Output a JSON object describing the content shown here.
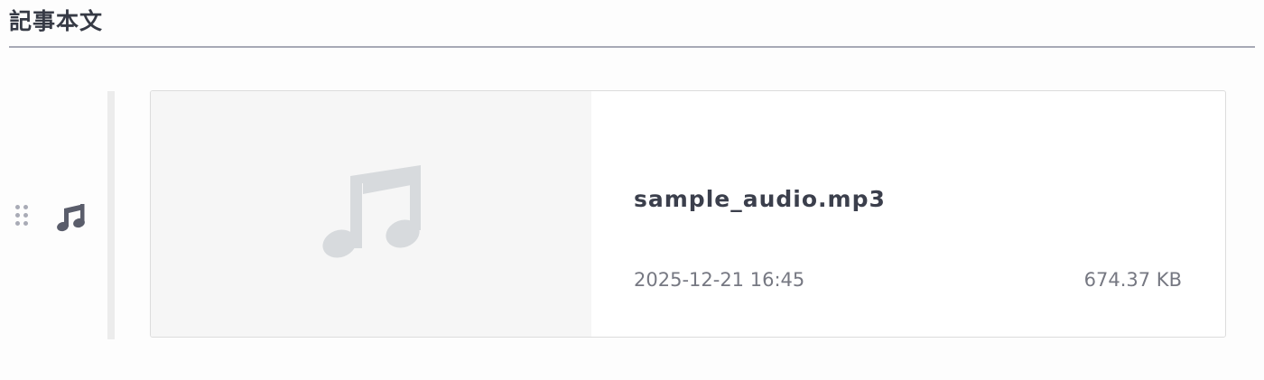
{
  "section": {
    "title": "記事本文"
  },
  "block": {
    "drag_handle_icon": "drag-dots-icon",
    "type_icon": "music-note-icon",
    "type_icon_color": "#5a5d6b"
  },
  "media": {
    "thumbnail_icon": "music-note-icon",
    "thumbnail_icon_color": "#d7dadd",
    "file_name": "sample_audio.mp3",
    "date": "2025-12-21 16:45",
    "size": "674.37 KB"
  }
}
